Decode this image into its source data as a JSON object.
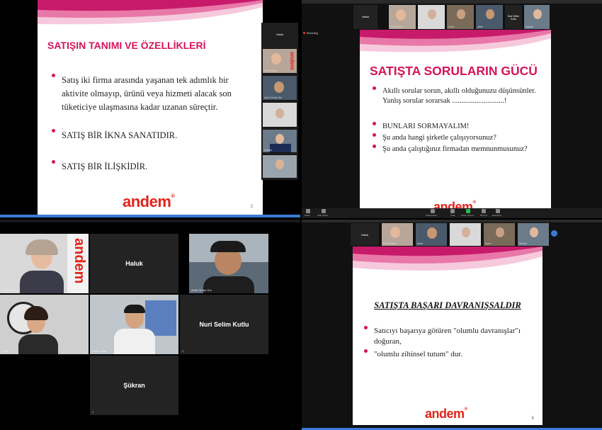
{
  "q1": {
    "slide": {
      "title": "SATIŞIN TANIMI VE ÖZELLİKLERİ",
      "bullets": [
        "Satış iki firma arasında yaşanan tek adımlık bir aktivite olmayıp, ürünü veya hizmeti alacak son tüketiciye ulaşmasına kadar uzanan süreçtir.",
        "SATIŞ BİR İKNA SANATIDIR.",
        "SATIŞ BİR İLİŞKİDİR."
      ],
      "logo": "andem",
      "page": "2"
    },
    "sidebar_top": "Haluk",
    "thumbs": [
      "Pelin Gurel",
      "Abdil Orhan Gul",
      "Nuri",
      "Sukran"
    ]
  },
  "q2": {
    "top_names": [
      "Haluk",
      "Nuri Selim Kutlu"
    ],
    "thumbs": [
      "Pelin Gurel",
      "Nuri",
      "Suna",
      "Abdil",
      "Sukran"
    ],
    "recording": "Recording",
    "slide": {
      "title": "SATIŞTA SORULARIN GÜCÜ",
      "bullets": [
        "Akıllı sorular sorun, akıllı olduğunuzu düşünsünler. Yanlış sorular sorarsak ............................!",
        "BUNLARI SORMAYALIM!",
        "Şu anda hangi şirketle çalışıyorsunuz?",
        "Şu anda çalıştığınız firmadan memnunmusunuz?"
      ],
      "logo": "andem"
    },
    "toolbar": [
      "Audio",
      "Start Video",
      "Participants",
      "Chat",
      "Share Screen",
      "Record",
      "Reactions"
    ]
  },
  "q3": {
    "tiles": [
      {
        "type": "video",
        "name": "Pelin Gurel"
      },
      {
        "type": "name",
        "label": "Haluk",
        "num": ""
      },
      {
        "type": "video",
        "name": "Abdil Orhan Gul"
      },
      {
        "type": "video",
        "name": "Suna"
      },
      {
        "type": "video",
        "name": "Selim Kutlu"
      },
      {
        "type": "name",
        "label": "Nuri Selim Kutlu",
        "num": "2"
      },
      {
        "type": "name",
        "label": "Şükran",
        "num": "2"
      }
    ]
  },
  "q4": {
    "top_name": "Haluk",
    "thumbs": [
      "Pelin Gurel",
      "Abdil",
      "Nuri",
      "Suna",
      "Sukran"
    ],
    "slide": {
      "title": "SATIŞTA BAŞARI DAVRANIŞSALDIR",
      "bullets": [
        "Satıcıyı başarıya götüren \"olumlu davranışlar\"ı doğuran,",
        "\"olumlu zihinsel tutum\" dur."
      ],
      "logo": "andem",
      "page": "6"
    }
  },
  "colors": {
    "accent": "#d4145a",
    "logo": "#e2231a",
    "zoom_blue": "#3a7bd5"
  }
}
